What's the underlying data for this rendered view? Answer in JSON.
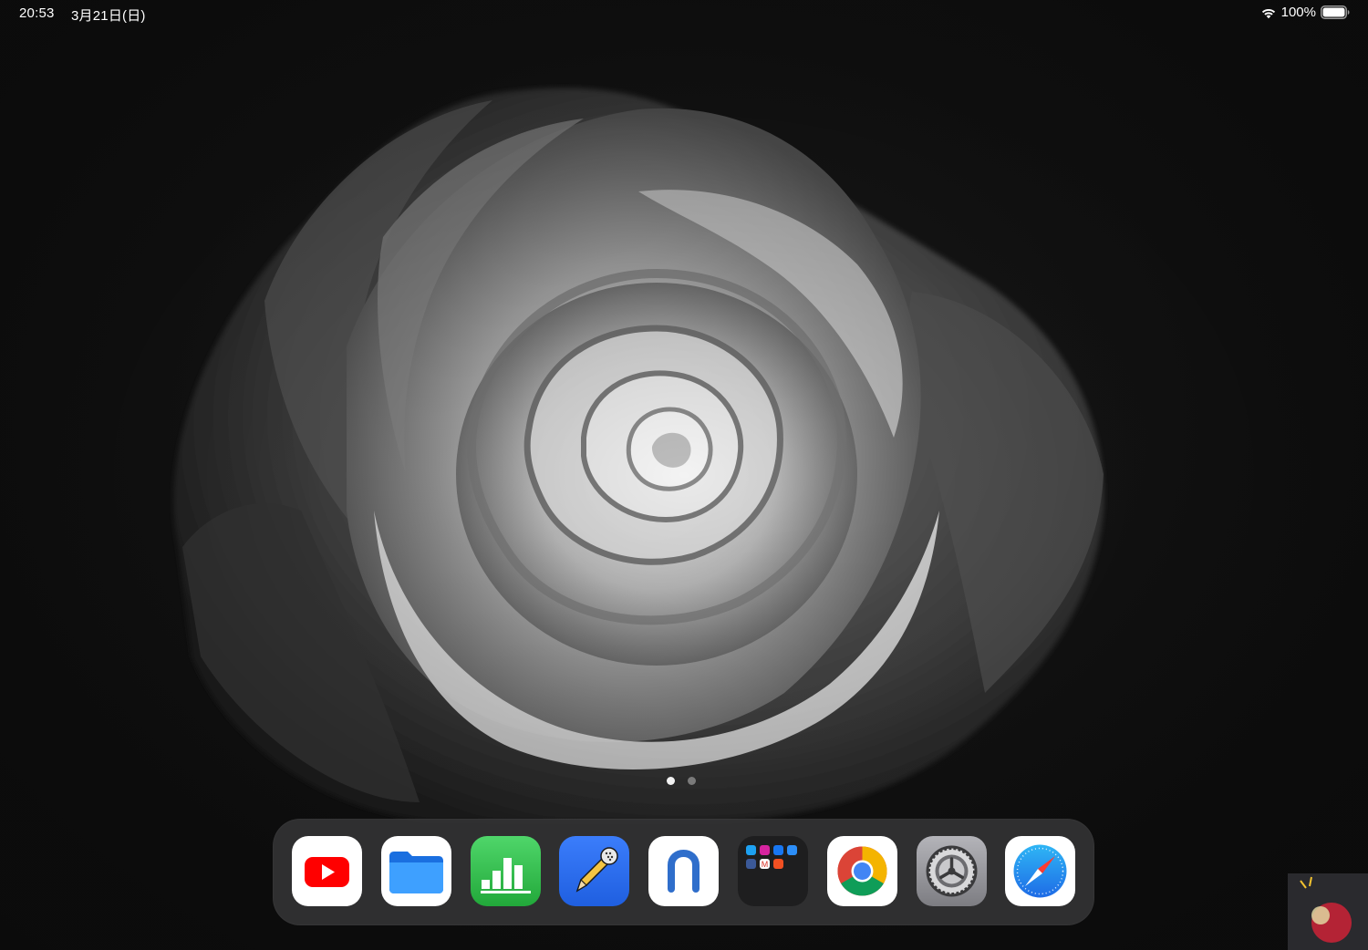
{
  "status_bar": {
    "time": "20:53",
    "date": "3月21日(日)",
    "battery_percent": "100%",
    "battery_level": 1.0,
    "wifi_icon": "wifi-icon",
    "battery_icon": "battery-icon"
  },
  "wallpaper": {
    "subject": "rose-flower",
    "colors": {
      "background": "#141414",
      "petal_light": "#d9d9d9",
      "petal_dark": "#3a3a3a"
    }
  },
  "page_indicator": {
    "page_count": 2,
    "current_page": 1
  },
  "dock": {
    "apps": [
      {
        "id": "youtube",
        "icon": "youtube-icon",
        "color": "#ff0000"
      },
      {
        "id": "files",
        "icon": "folder-icon",
        "color": "#1a7ff0"
      },
      {
        "id": "numbers",
        "icon": "bar-chart-icon",
        "color": "#34c759"
      },
      {
        "id": "notability",
        "icon": "pencil-microphone-icon",
        "color": "#2d6cf6"
      },
      {
        "id": "notion-like",
        "icon": "n-letter-icon",
        "color": "#2f6ecb"
      },
      {
        "id": "app-folder",
        "icon": "folder-grid-icon",
        "color": "#1e1e1e"
      },
      {
        "id": "chrome",
        "icon": "chrome-icon",
        "color": "#4285f4"
      },
      {
        "id": "settings",
        "icon": "gear-icon",
        "color": "#8e8e93"
      },
      {
        "id": "safari",
        "icon": "compass-icon",
        "color": "#1e88e5"
      }
    ]
  }
}
